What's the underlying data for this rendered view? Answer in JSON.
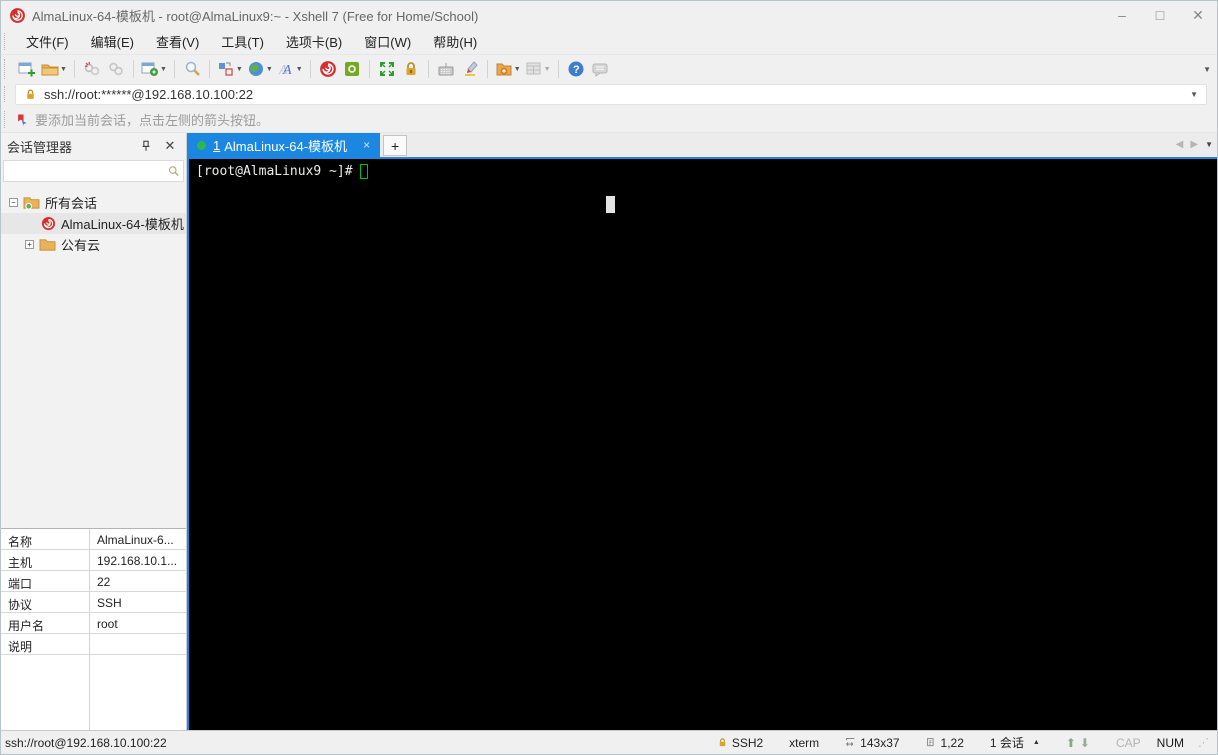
{
  "window": {
    "title": "AlmaLinux-64-模板机 - root@AlmaLinux9:~ - Xshell 7 (Free for Home/School)",
    "controls": {
      "minimize": "–",
      "maximize": "□",
      "close": "✕"
    }
  },
  "menu": {
    "items": [
      "文件(F)",
      "编辑(E)",
      "查看(V)",
      "工具(T)",
      "选项卡(B)",
      "窗口(W)",
      "帮助(H)"
    ]
  },
  "toolbar": {
    "icons": [
      "new-session",
      "open-folder",
      "disconnect",
      "reconnect",
      "session-properties",
      "find",
      "arrange-layout",
      "web-browser",
      "font",
      "xshell-logo",
      "xftp-transfer",
      "fullscreen",
      "lock-screen",
      "virtual-keyboard",
      "highlight-pen",
      "new-file",
      "tile-windows",
      "help",
      "feedback"
    ]
  },
  "address_bar": {
    "value": "ssh://root:******@192.168.10.100:22"
  },
  "info_bar": {
    "text": "要添加当前会话，点击左侧的箭头按钮。"
  },
  "session_manager": {
    "title": "会话管理器",
    "search_value": "",
    "tree": {
      "root_label": "所有会话",
      "session_label": "AlmaLinux-64-模板机",
      "folder_label": "公有云"
    },
    "properties": [
      {
        "label": "名称",
        "value": "AlmaLinux-6..."
      },
      {
        "label": "主机",
        "value": "192.168.10.1..."
      },
      {
        "label": "端口",
        "value": "22"
      },
      {
        "label": "协议",
        "value": "SSH"
      },
      {
        "label": "用户名",
        "value": "root"
      },
      {
        "label": "说明",
        "value": ""
      }
    ]
  },
  "tabs": {
    "active_number": "1",
    "active_label": "AlmaLinux-64-模板机",
    "close_glyph": "×",
    "new_tab_glyph": "+"
  },
  "terminal": {
    "prompt": "[root@AlmaLinux9 ~]#"
  },
  "status_bar": {
    "url": "ssh://root@192.168.10.100:22",
    "protocol": "SSH2",
    "term_type": "xterm",
    "size": "143x37",
    "cursor_pos": "1,22",
    "session_count": "1 会话",
    "cap_label": "CAP",
    "num_label": "NUM"
  },
  "colors": {
    "accent_blue": "#1b87e0",
    "tab_dot_green": "#2db84c",
    "terminal_cursor_green": "#00c200",
    "xshell_red": "#d32f2f",
    "lock_gold": "#d9a62b"
  }
}
